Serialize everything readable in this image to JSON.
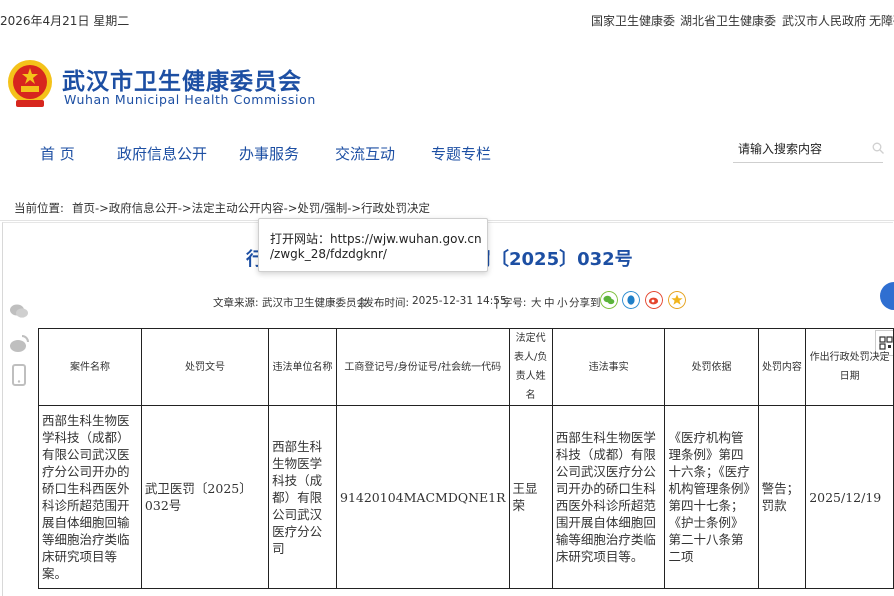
{
  "topbar": {
    "date": "2026年4月21日 星期二",
    "links": [
      "国家卫生健康委",
      "湖北省卫生健康委",
      "武汉市人民政府",
      "无障碍"
    ]
  },
  "logo": {
    "cn": "武汉市卫生健康委员会",
    "en": "Wuhan Municipal Health Commission"
  },
  "nav": {
    "items": [
      "首 页",
      "政府信息公开",
      "办事服务",
      "交流互动",
      "专题专栏"
    ],
    "search_placeholder": "请输入搜索内容"
  },
  "breadcrumb": {
    "label": "当前位置:",
    "path": "首页->政府信息公开->法定主动公开内容->处罚/强制->行政处罚决定"
  },
  "tooltip": {
    "line1": "打开网站：https://wjw.wuhan.gov.cn",
    "line2": "/zwgk_28/fdzdgknr/"
  },
  "article": {
    "title_left": "行",
    "title_right": "医罚〔2025〕032号",
    "meta_source_label": "文章来源:",
    "meta_source": "武汉市卫生健康委员会",
    "meta_time_label": "|发布时间:",
    "meta_time": "2025-12-31 14:55",
    "meta_size_label": "| 字号:",
    "meta_sizes": [
      "大",
      "中",
      "小"
    ],
    "meta_share": "分享到"
  },
  "table": {
    "headers": [
      "案件名称",
      "处罚文号",
      "违法单位名称",
      "工商登记号/身份证号/社会统一代码",
      "法定代表人/负责人姓名",
      "违法事实",
      "处罚依据",
      "处罚内容",
      "作出行政处罚决定日期"
    ],
    "row": [
      "西部生科生物医学科技（成都）有限公司武汉医疗分公司开办的硚口生科西医外科诊所超范围开展自体细胞回输等细胞治疗类临床研究项目等案。",
      "武卫医罚〔2025〕032号",
      "西部生科生物医学科技（成都）有限公司武汉医疗分公司",
      "91420104MACMDQNE1R",
      "王显荣",
      "西部生科生物医学科技（成都）有限公司武汉医疗分公司开办的硚口生科西医外科诊所超范围开展自体细胞回输等细胞治疗类临床研究项目等。",
      "《医疗机构管理条例》第四十六条；《医疗机构管理条例》第四十七条；《护士条例》第二十八条第二项",
      "警告；罚款",
      "2025/12/19"
    ]
  },
  "colors": {
    "brand_blue": "#1d4fa3",
    "emblem_red": "#d7261e",
    "emblem_gold": "#f4c21a"
  }
}
